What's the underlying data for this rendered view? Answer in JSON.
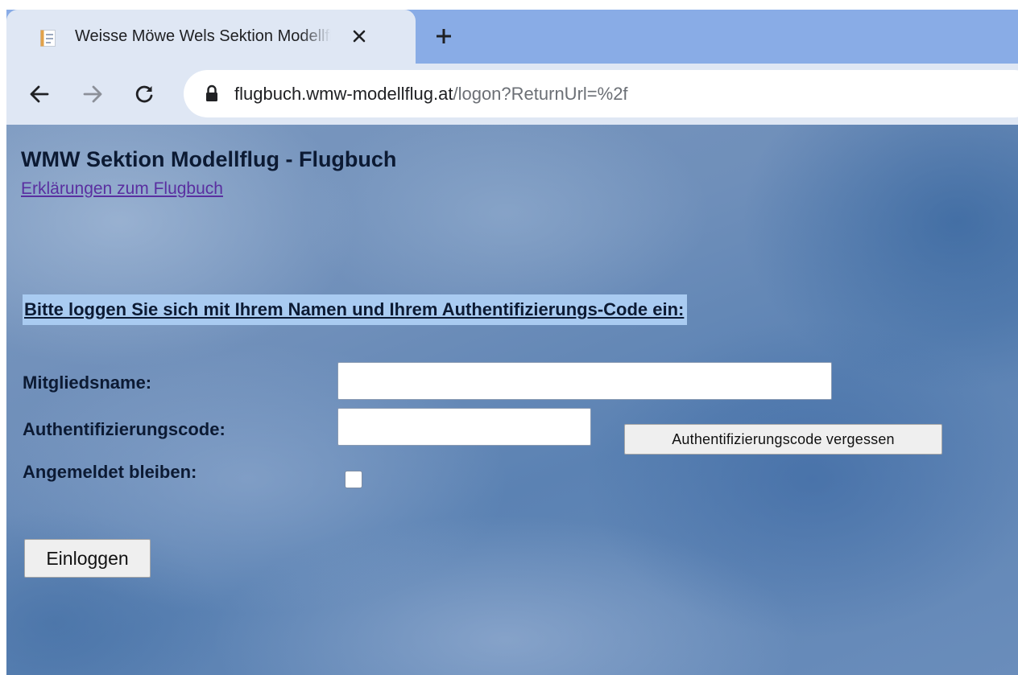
{
  "browser": {
    "tab": {
      "title": "Weisse Möwe Wels Sektion Modellflug - Flugbuch",
      "favicon": "page-icon",
      "close_icon": "close-icon"
    },
    "new_tab_icon": "plus-icon",
    "nav": {
      "back_icon": "arrow-left-icon",
      "forward_icon": "arrow-right-icon",
      "reload_icon": "reload-icon"
    },
    "address_bar": {
      "lock_icon": "lock-icon",
      "host": "flugbuch.wmw-modellflug.at",
      "path": "/logon?ReturnUrl=%2f"
    },
    "colors": {
      "tabstrip": "#89ace6",
      "toolbar": "#dfe7f4"
    }
  },
  "page": {
    "title": "WMW Sektion Modellflug - Flugbuch",
    "help_link": "Erklärungen zum Flugbuch",
    "instruction": "Bitte loggen Sie sich mit Ihrem Namen und Ihrem Authentifizierungs-Code ein:",
    "instruction_highlight_color": "#a9cbf1",
    "form": {
      "member_name": {
        "label": "Mitgliedsname:",
        "value": ""
      },
      "auth_code": {
        "label": "Authentifizierungscode:",
        "value": ""
      },
      "forgot_button": "Authentifizierungscode vergessen",
      "remember_me": {
        "label": "Angemeldet bleiben:",
        "checked": false
      },
      "login_button": "Einloggen"
    }
  }
}
